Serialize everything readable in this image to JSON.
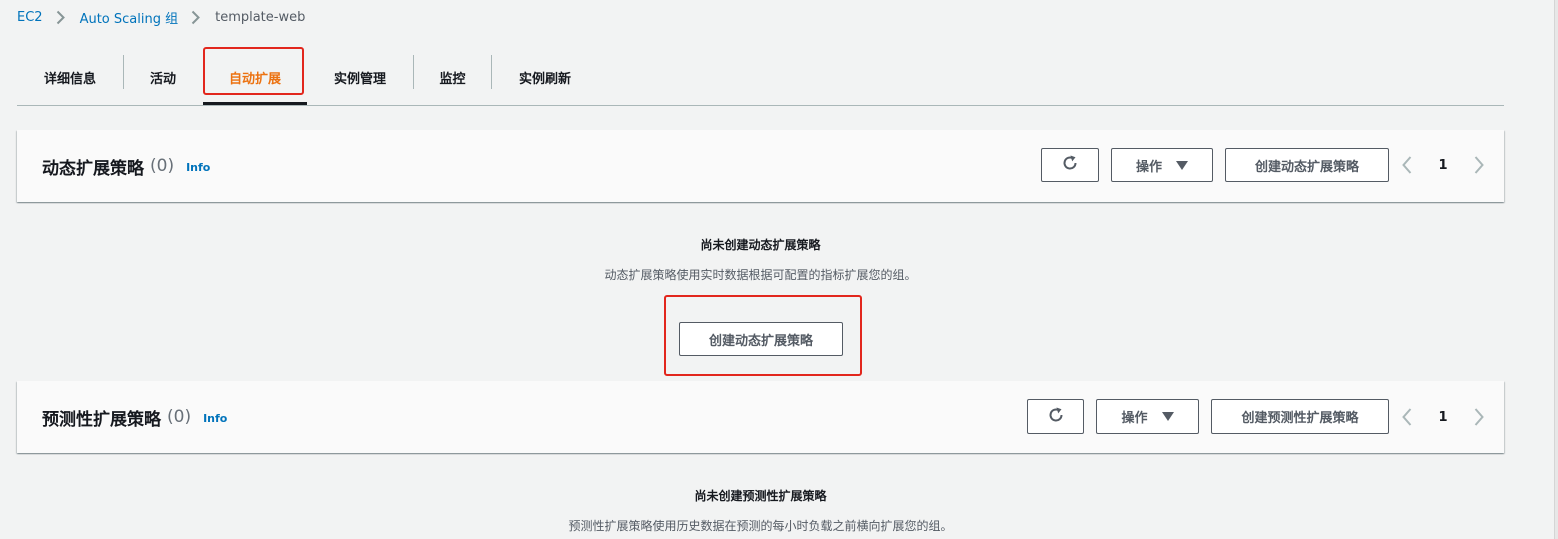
{
  "breadcrumb": {
    "items": [
      "EC2",
      "Auto Scaling 组"
    ],
    "current": "template-web"
  },
  "tabs": [
    "详细信息",
    "活动",
    "自动扩展",
    "实例管理",
    "监控",
    "实例刷新"
  ],
  "active_tab": "自动扩展",
  "colors": {
    "link": "#0073bb",
    "active_tab": "#ec7211",
    "highlight": "#e2261c",
    "page_bg": "#f2f3f3"
  },
  "dynamic": {
    "title": "动态扩展策略",
    "count": "(0)",
    "info": "Info",
    "refresh_icon": "refresh-icon",
    "actions": "操作",
    "create": "创建动态扩展策略",
    "page": "1",
    "empty_title": "尚未创建动态扩展策略",
    "empty_desc": "动态扩展策略使用实时数据根据可配置的指标扩展您的组。",
    "empty_button": "创建动态扩展策略"
  },
  "predictive": {
    "title": "预测性扩展策略",
    "count": "(0)",
    "info": "Info",
    "refresh_icon": "refresh-icon",
    "actions": "操作",
    "create": "创建预测性扩展策略",
    "page": "1",
    "empty_title": "尚未创建预测性扩展策略",
    "empty_desc": "预测性扩展策略使用历史数据在预测的每小时负载之前横向扩展您的组。"
  }
}
